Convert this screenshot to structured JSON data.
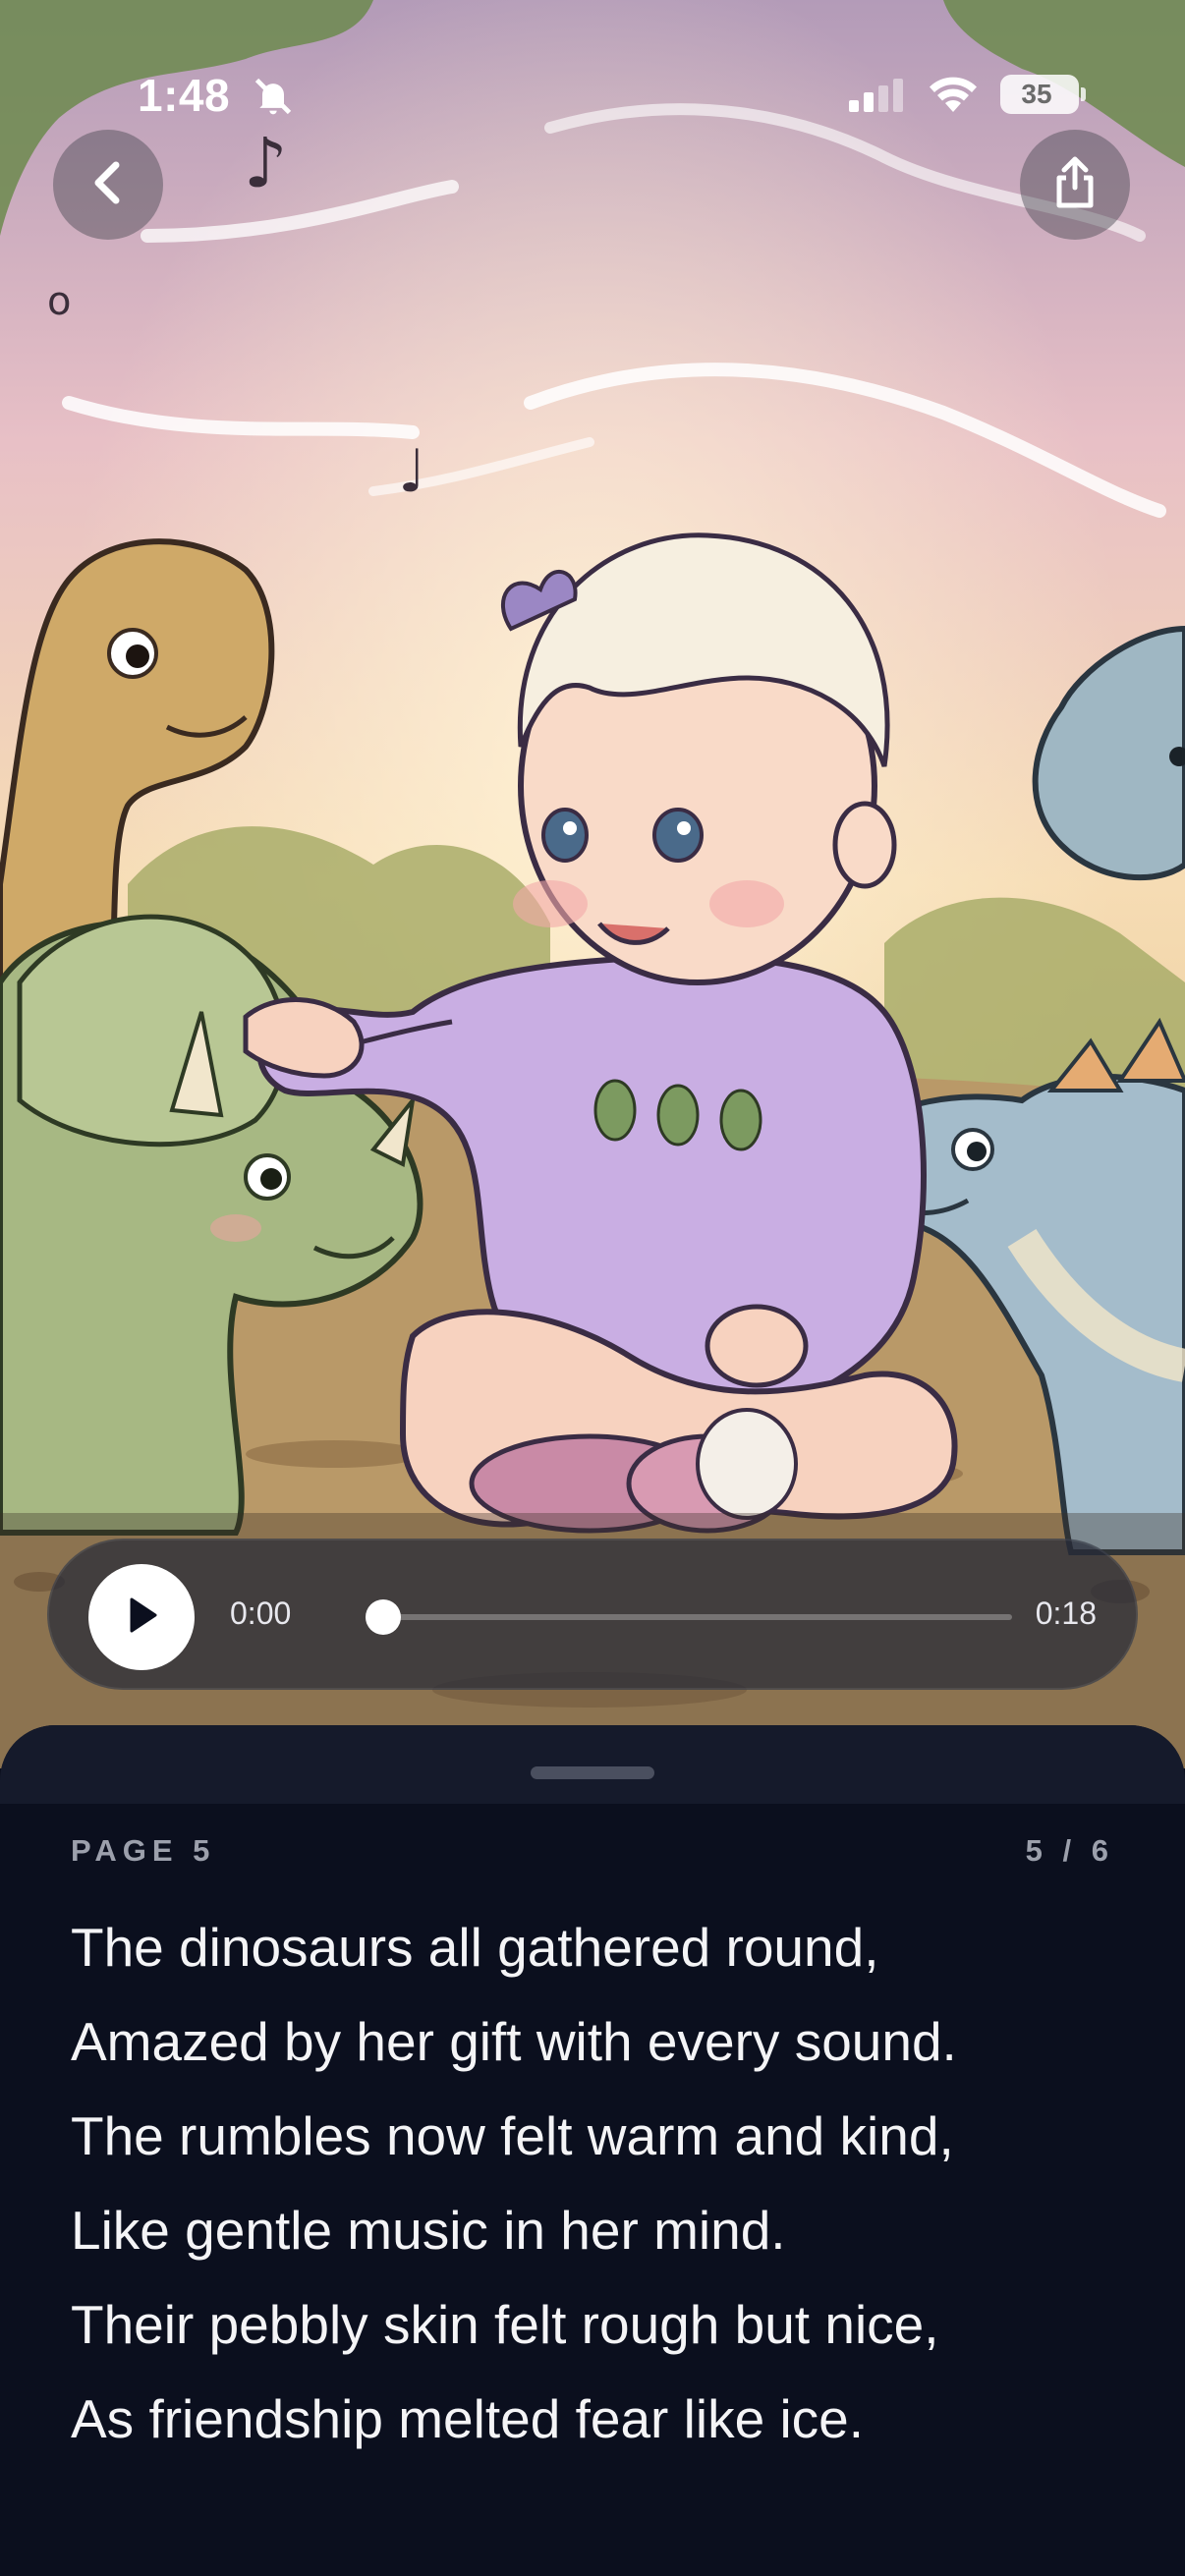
{
  "status_bar": {
    "time": "1:48",
    "battery": "35"
  },
  "player": {
    "current_time": "0:00",
    "total_time": "0:18",
    "progress": 0
  },
  "page": {
    "label": "PAGE 5",
    "count": "5 / 6",
    "lines": [
      "The dinosaurs all gathered round,",
      "Amazed by her gift with every sound.",
      "The rumbles now felt warm and kind,",
      "Like gentle music in her mind.",
      "Their pebbly skin felt rough but nice,",
      "As friendship melted fear like ice."
    ]
  },
  "colors": {
    "sheet_background": "#0b0f1e",
    "accent_text": "#9ca0ac",
    "onesie": "#c9aee3"
  },
  "icons": [
    "bell-off-icon",
    "signal-icon",
    "wifi-icon",
    "battery-icon",
    "chevron-left-icon",
    "share-icon",
    "play-icon"
  ]
}
